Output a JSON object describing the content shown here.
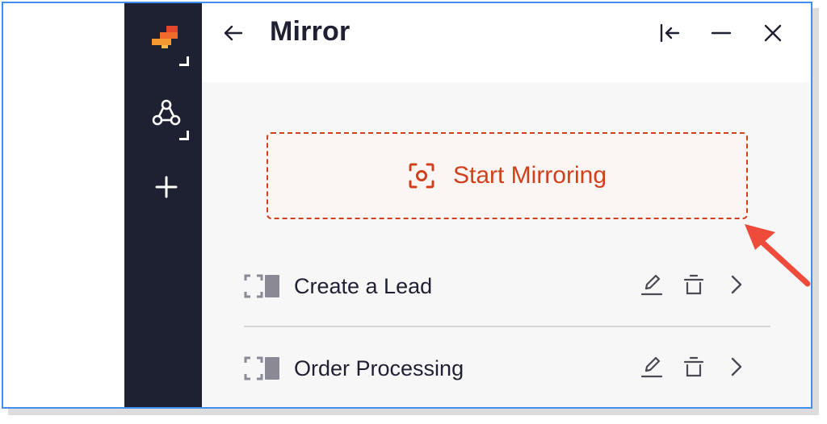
{
  "panel": {
    "title": "Mirror"
  },
  "start_button": {
    "label": "Start Mirroring"
  },
  "flows": [
    {
      "label": "Create a Lead"
    },
    {
      "label": "Order Processing"
    }
  ],
  "icons": {
    "sidebar": [
      "logo-icon",
      "network-icon",
      "plus-icon"
    ],
    "header": [
      "back-arrow-icon",
      "collapse-panel-icon",
      "minimize-icon",
      "close-icon"
    ],
    "start": "screen-capture-icon",
    "row": [
      "flow-icon",
      "edit-icon",
      "delete-icon",
      "chevron-right-icon"
    ]
  },
  "colors": {
    "accent": "#d0411b",
    "sidebar_bg": "#1e2132",
    "frame_border": "#3f8ef0",
    "annotation_arrow": "#ee4b3b"
  }
}
